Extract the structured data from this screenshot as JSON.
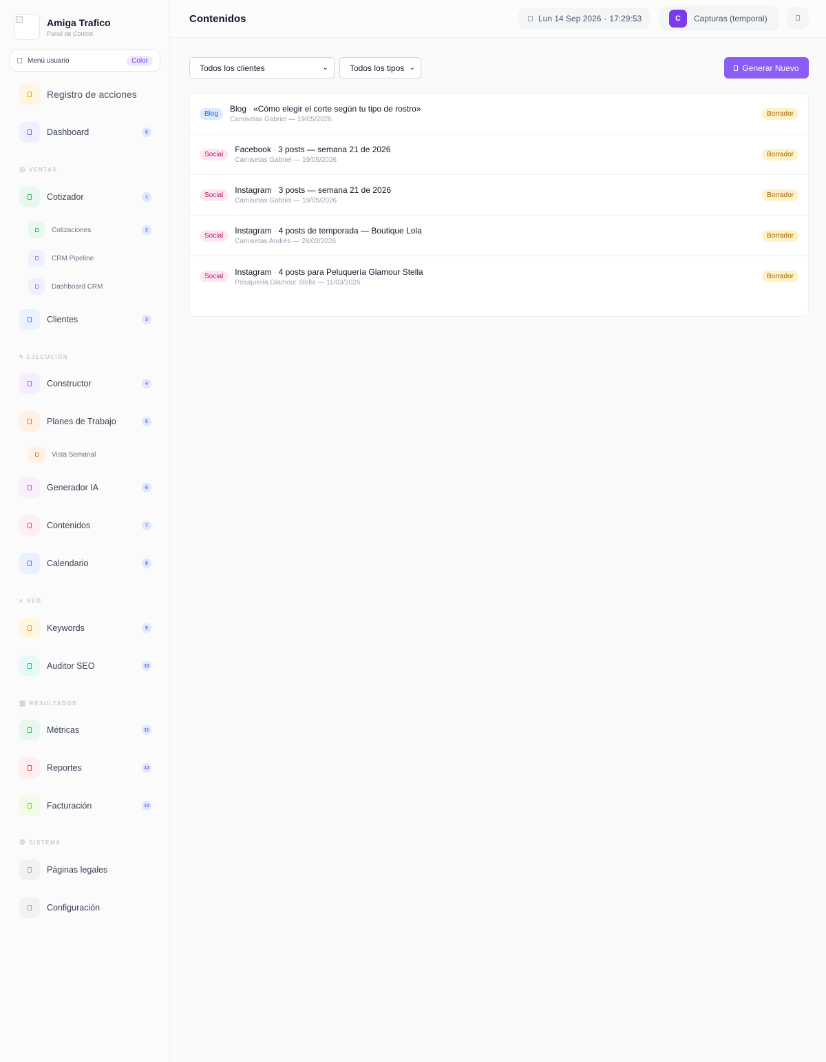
{
  "brand": {
    "title": "Amiga Trafico",
    "subtitle": "Panel de Control"
  },
  "user_menu": {
    "label": "Menú usuario",
    "badge": "Color"
  },
  "sidebar": {
    "top_items": [
      {
        "label": "Registro de acciones",
        "icon": "history-icon"
      },
      {
        "label": "Dashboard",
        "count": "0",
        "icon": "dashboard-icon"
      }
    ],
    "sections": {
      "ventas": "VENTAS",
      "ejecucion": "EJECUCIÓN",
      "seo": "SEO",
      "resultados": "RESULTADOS",
      "sistema": "SISTEMA"
    },
    "items": {
      "cotizador": {
        "label": "Cotizador",
        "count": "1"
      },
      "cotizaciones": {
        "label": "Cotizaciones",
        "count": "2"
      },
      "crm_pipeline": {
        "label": "CRM Pipeline"
      },
      "dashboard_crm": {
        "label": "Dashboard CRM"
      },
      "clientes": {
        "label": "Clientes",
        "count": "3"
      },
      "constructor": {
        "label": "Constructor",
        "count": "4"
      },
      "planes": {
        "label": "Planes de Trabajo",
        "count": "5"
      },
      "vista_semanal": {
        "label": "Vista Semanal"
      },
      "generador": {
        "label": "Generador IA",
        "count": "6"
      },
      "contenidos": {
        "label": "Contenidos",
        "count": "7"
      },
      "calendario": {
        "label": "Calendario",
        "count": "8"
      },
      "keywords": {
        "label": "Keywords",
        "count": "9"
      },
      "auditor": {
        "label": "Auditor SEO",
        "count": "10"
      },
      "metricas": {
        "label": "Métricas",
        "count": "11"
      },
      "reportes": {
        "label": "Reportes",
        "count": "12"
      },
      "facturacion": {
        "label": "Facturación",
        "count": "13"
      },
      "legales": {
        "label": "Páginas legales"
      },
      "configuracion": {
        "label": "Configuración"
      }
    }
  },
  "header": {
    "title": "Contenidos",
    "date": "Lun 14 Sep 2026",
    "separator": "·",
    "time": "17:29:53",
    "workspace_initial": "C",
    "workspace_label": "Capturas (temporal)"
  },
  "filters": {
    "clients": "Todos los clientes",
    "types": "Todos los tipos",
    "generate": "Generar Nuevo"
  },
  "colors": {
    "accent": "#8b5cf6",
    "workspace": "#7c3aed"
  },
  "contents": [
    {
      "type": "Blog",
      "channel": "Blog",
      "title": "«Cómo elegir el corte según tu tipo de rostro»",
      "meta": "Camisetas Gabriel — 19/05/2026",
      "status": "Borrador"
    },
    {
      "type": "Social",
      "channel": "Facebook",
      "title": "3 posts — semana 21 de 2026",
      "meta": "Camisetas Gabriel — 19/05/2026",
      "status": "Borrador"
    },
    {
      "type": "Social",
      "channel": "Instagram",
      "title": "3 posts — semana 21 de 2026",
      "meta": "Camisetas Gabriel — 19/05/2026",
      "status": "Borrador"
    },
    {
      "type": "Social",
      "channel": "Instagram",
      "title": "4 posts de temporada — Boutique Lola",
      "meta": "Camisetas Andrés — 28/03/2026",
      "status": "Borrador"
    },
    {
      "type": "Social",
      "channel": "Instagram",
      "title": "4 posts para Peluquería Glamour Stella",
      "meta": "Peluquería Glamour Stella — 11/03/2026",
      "status": "Borrador"
    }
  ]
}
